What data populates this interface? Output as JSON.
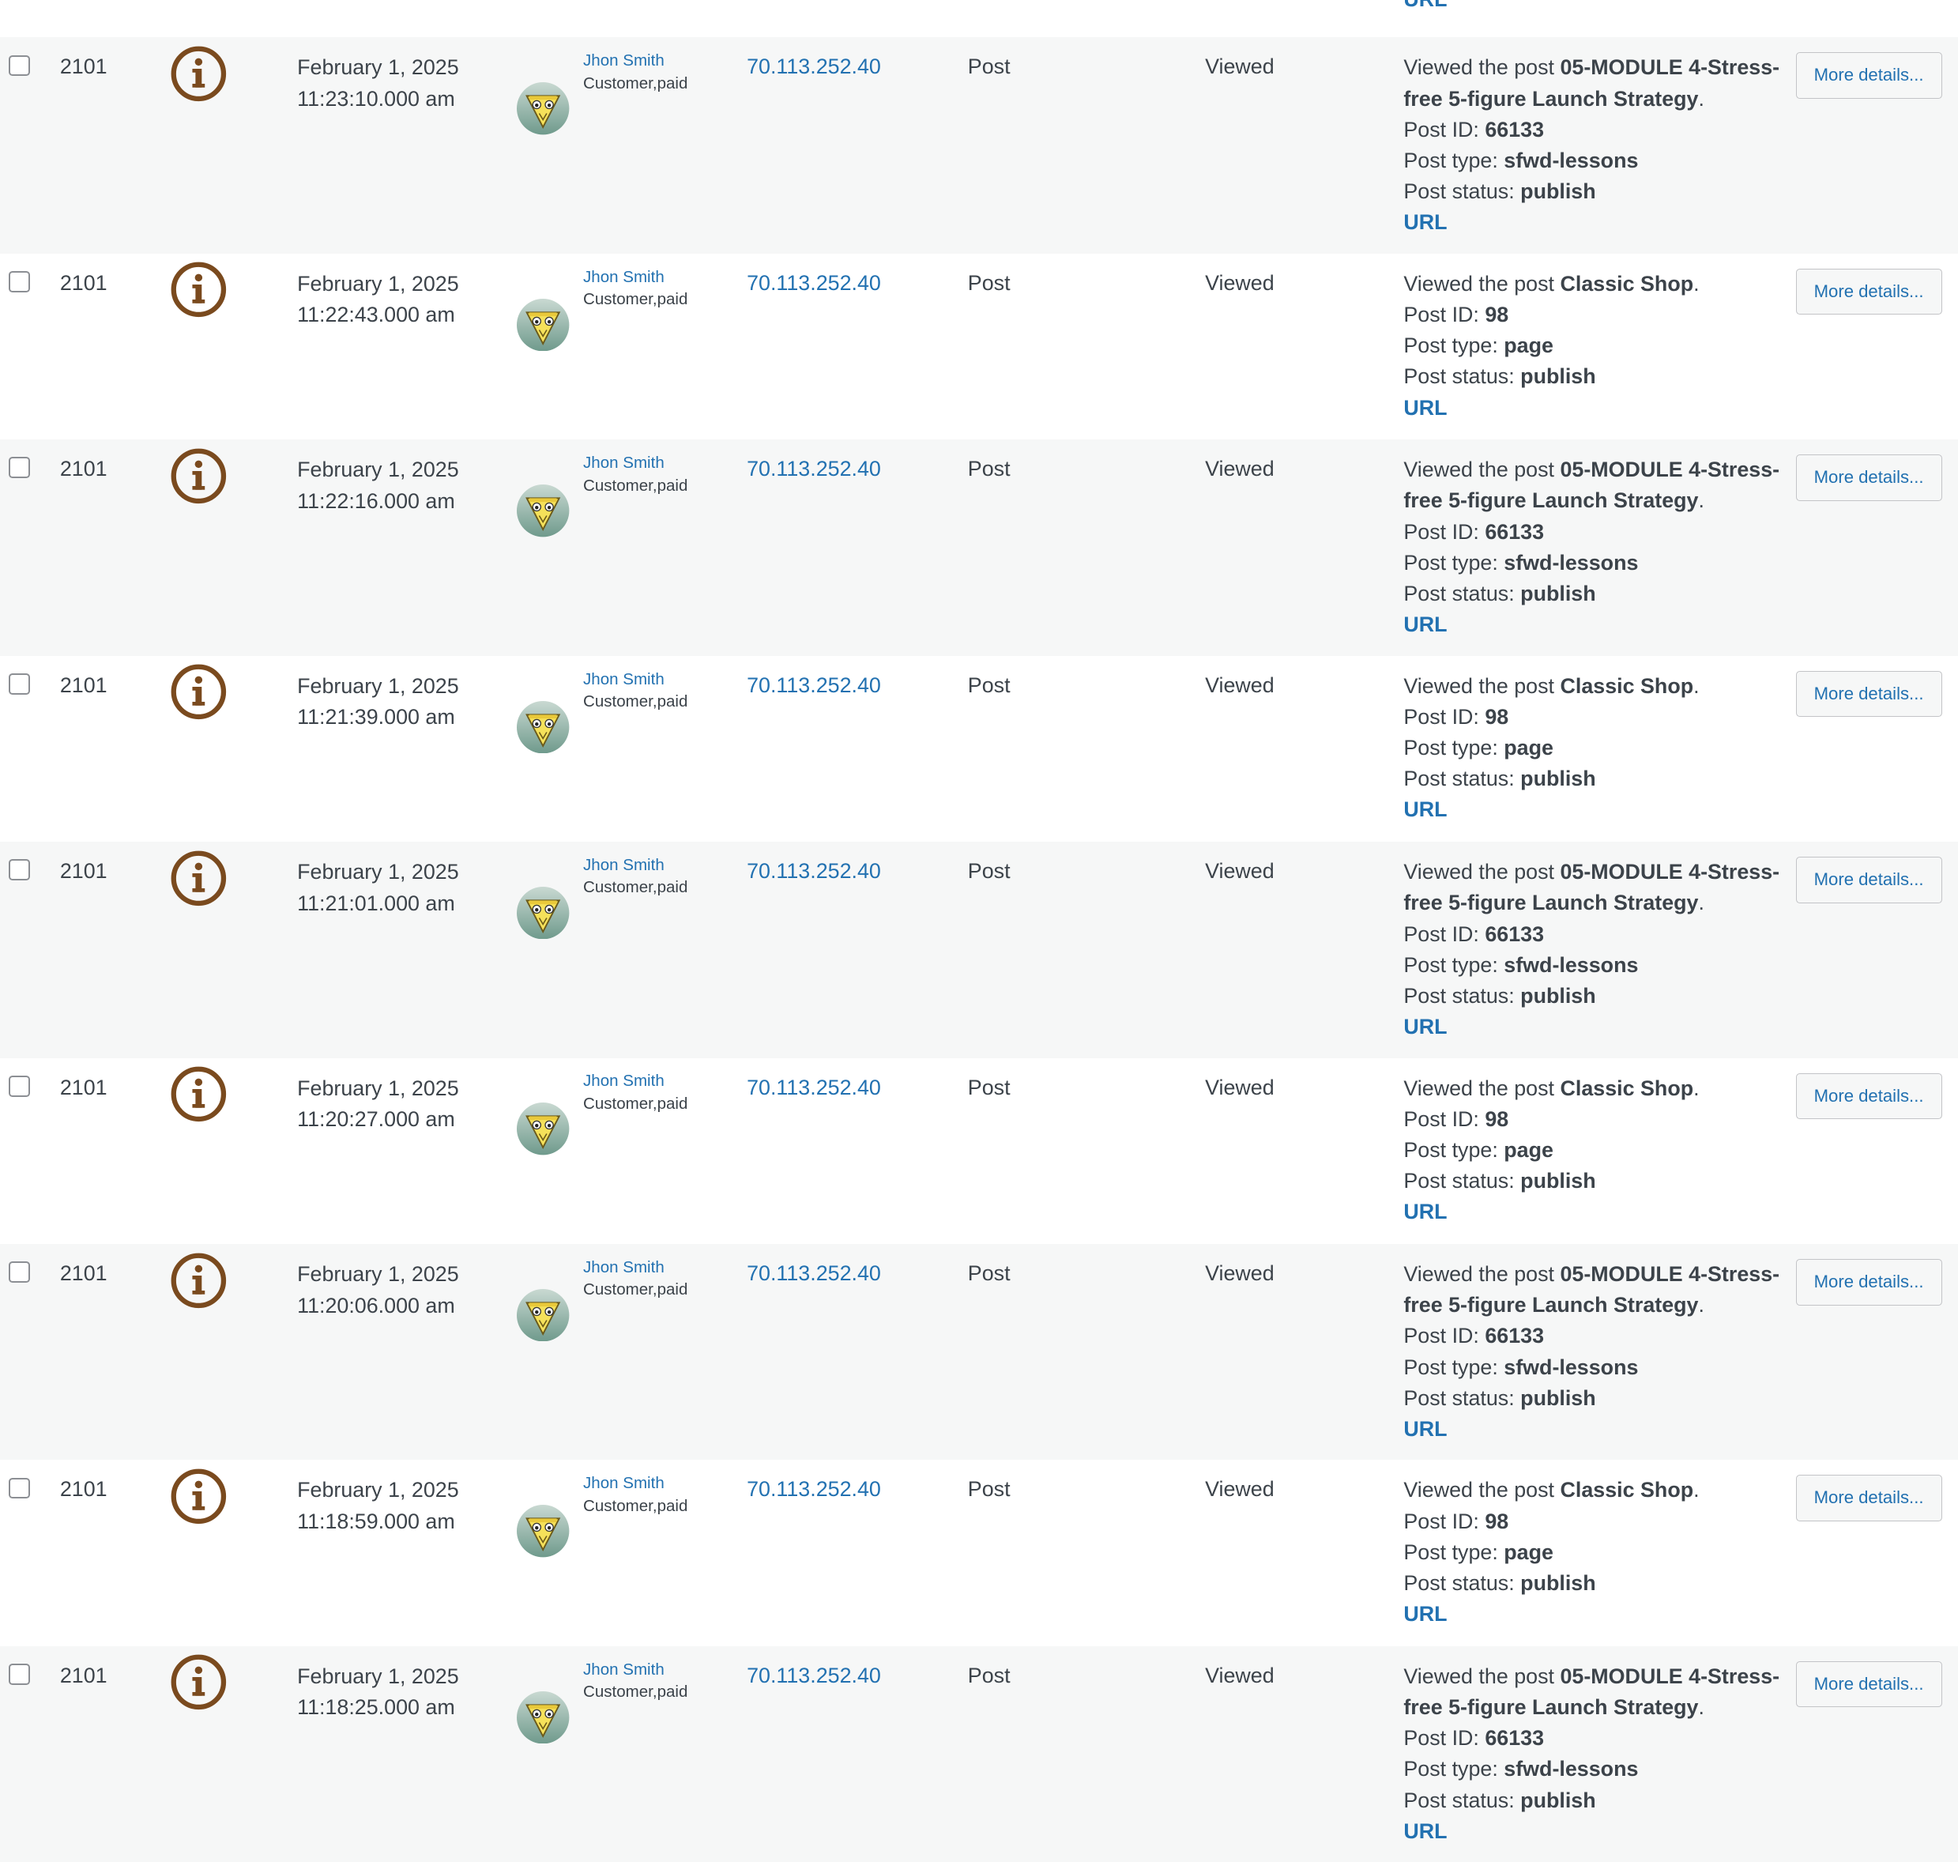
{
  "top_fragment": {
    "url_label": "URL"
  },
  "rows": [
    {
      "id": "2101",
      "date": "February 1, 2025",
      "time": "11:23:10.000 am",
      "user_name": "Jhon Smith",
      "user_role": "Customer,paid",
      "ip": "70.113.252.40",
      "context": "Post",
      "action": "Viewed",
      "msg_prefix": "Viewed the post ",
      "post_title": "05-MODULE 4-Stress-free 5-figure Launch Strategy",
      "msg_suffix": ".",
      "post_id_label": "Post ID: ",
      "post_id": "66133",
      "post_type_label": "Post type: ",
      "post_type": "sfwd-lessons",
      "post_status_label": "Post status: ",
      "post_status": "publish",
      "url_label": "URL",
      "more_label": "More details..."
    },
    {
      "id": "2101",
      "date": "February 1, 2025",
      "time": "11:22:43.000 am",
      "user_name": "Jhon Smith",
      "user_role": "Customer,paid",
      "ip": "70.113.252.40",
      "context": "Post",
      "action": "Viewed",
      "msg_prefix": "Viewed the post ",
      "post_title": "Classic Shop",
      "msg_suffix": ".",
      "post_id_label": "Post ID: ",
      "post_id": "98",
      "post_type_label": "Post type: ",
      "post_type": "page",
      "post_status_label": "Post status: ",
      "post_status": "publish",
      "url_label": "URL",
      "more_label": "More details..."
    },
    {
      "id": "2101",
      "date": "February 1, 2025",
      "time": "11:22:16.000 am",
      "user_name": "Jhon Smith",
      "user_role": "Customer,paid",
      "ip": "70.113.252.40",
      "context": "Post",
      "action": "Viewed",
      "msg_prefix": "Viewed the post ",
      "post_title": "05-MODULE 4-Stress-free 5-figure Launch Strategy",
      "msg_suffix": ".",
      "post_id_label": "Post ID: ",
      "post_id": "66133",
      "post_type_label": "Post type: ",
      "post_type": "sfwd-lessons",
      "post_status_label": "Post status: ",
      "post_status": "publish",
      "url_label": "URL",
      "more_label": "More details..."
    },
    {
      "id": "2101",
      "date": "February 1, 2025",
      "time": "11:21:39.000 am",
      "user_name": "Jhon Smith",
      "user_role": "Customer,paid",
      "ip": "70.113.252.40",
      "context": "Post",
      "action": "Viewed",
      "msg_prefix": "Viewed the post ",
      "post_title": "Classic Shop",
      "msg_suffix": ".",
      "post_id_label": "Post ID: ",
      "post_id": "98",
      "post_type_label": "Post type: ",
      "post_type": "page",
      "post_status_label": "Post status: ",
      "post_status": "publish",
      "url_label": "URL",
      "more_label": "More details..."
    },
    {
      "id": "2101",
      "date": "February 1, 2025",
      "time": "11:21:01.000 am",
      "user_name": "Jhon Smith",
      "user_role": "Customer,paid",
      "ip": "70.113.252.40",
      "context": "Post",
      "action": "Viewed",
      "msg_prefix": "Viewed the post ",
      "post_title": "05-MODULE 4-Stress-free 5-figure Launch Strategy",
      "msg_suffix": ".",
      "post_id_label": "Post ID: ",
      "post_id": "66133",
      "post_type_label": "Post type: ",
      "post_type": "sfwd-lessons",
      "post_status_label": "Post status: ",
      "post_status": "publish",
      "url_label": "URL",
      "more_label": "More details..."
    },
    {
      "id": "2101",
      "date": "February 1, 2025",
      "time": "11:20:27.000 am",
      "user_name": "Jhon Smith",
      "user_role": "Customer,paid",
      "ip": "70.113.252.40",
      "context": "Post",
      "action": "Viewed",
      "msg_prefix": "Viewed the post ",
      "post_title": "Classic Shop",
      "msg_suffix": ".",
      "post_id_label": "Post ID: ",
      "post_id": "98",
      "post_type_label": "Post type: ",
      "post_type": "page",
      "post_status_label": "Post status: ",
      "post_status": "publish",
      "url_label": "URL",
      "more_label": "More details..."
    },
    {
      "id": "2101",
      "date": "February 1, 2025",
      "time": "11:20:06.000 am",
      "user_name": "Jhon Smith",
      "user_role": "Customer,paid",
      "ip": "70.113.252.40",
      "context": "Post",
      "action": "Viewed",
      "msg_prefix": "Viewed the post ",
      "post_title": "05-MODULE 4-Stress-free 5-figure Launch Strategy",
      "msg_suffix": ".",
      "post_id_label": "Post ID: ",
      "post_id": "66133",
      "post_type_label": "Post type: ",
      "post_type": "sfwd-lessons",
      "post_status_label": "Post status: ",
      "post_status": "publish",
      "url_label": "URL",
      "more_label": "More details..."
    },
    {
      "id": "2101",
      "date": "February 1, 2025",
      "time": "11:18:59.000 am",
      "user_name": "Jhon Smith",
      "user_role": "Customer,paid",
      "ip": "70.113.252.40",
      "context": "Post",
      "action": "Viewed",
      "msg_prefix": "Viewed the post ",
      "post_title": "Classic Shop",
      "msg_suffix": ".",
      "post_id_label": "Post ID: ",
      "post_id": "98",
      "post_type_label": "Post type: ",
      "post_type": "page",
      "post_status_label": "Post status: ",
      "post_status": "publish",
      "url_label": "URL",
      "more_label": "More details..."
    },
    {
      "id": "2101",
      "date": "February 1, 2025",
      "time": "11:18:25.000 am",
      "user_name": "Jhon Smith",
      "user_role": "Customer,paid",
      "ip": "70.113.252.40",
      "context": "Post",
      "action": "Viewed",
      "msg_prefix": "Viewed the post ",
      "post_title": "05-MODULE 4-Stress-free 5-figure Launch Strategy",
      "msg_suffix": ".",
      "post_id_label": "Post ID: ",
      "post_id": "66133",
      "post_type_label": "Post type: ",
      "post_type": "sfwd-lessons",
      "post_status_label": "Post status: ",
      "post_status": "publish",
      "url_label": "URL",
      "more_label": "More details..."
    }
  ],
  "colors": {
    "info_icon": "#7a4a1e",
    "link": "#2271b1",
    "alt_row": "#f6f7f7"
  },
  "icons": {
    "severity": "info-icon",
    "avatar": "avatar-icon"
  }
}
